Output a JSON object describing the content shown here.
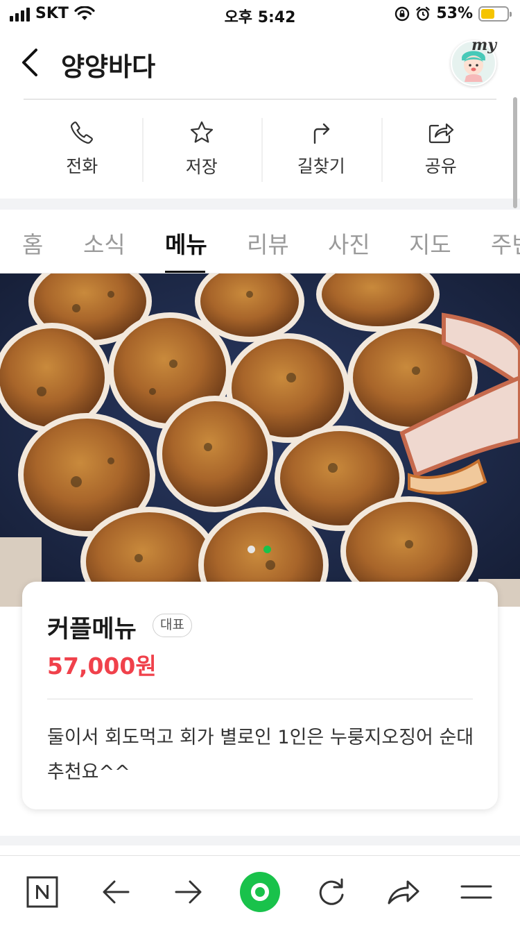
{
  "status_bar": {
    "carrier": "SKT",
    "time": "오후 5:42",
    "battery": "53%"
  },
  "header": {
    "title": "양양바다",
    "my_label": "my"
  },
  "actions": [
    {
      "label": "전화",
      "icon": "phone-icon"
    },
    {
      "label": "저장",
      "icon": "star-icon"
    },
    {
      "label": "길찾기",
      "icon": "directions-icon"
    },
    {
      "label": "공유",
      "icon": "share-icon"
    }
  ],
  "tabs": [
    {
      "label": "홈"
    },
    {
      "label": "소식"
    },
    {
      "label": "메뉴",
      "active": true
    },
    {
      "label": "리뷰"
    },
    {
      "label": "사진"
    },
    {
      "label": "지도"
    },
    {
      "label": "주변"
    }
  ],
  "photo": {
    "slide_count": 2,
    "active_slide": 2
  },
  "menu_item": {
    "name": "커플메뉴",
    "badge": "대표",
    "price": "57,000원",
    "description": "둘이서 회도먹고 회가 별로인 1인은 누룽지오징어 순대 추천요^^"
  },
  "bottom_bar": {
    "items": [
      "naver-home-icon",
      "back-arrow-icon",
      "forward-arrow-icon",
      "green-circle-icon",
      "reload-icon",
      "share-arrow-icon",
      "menu-icon"
    ]
  },
  "colors": {
    "price": "#f0414b",
    "active_dot": "#19c24b",
    "battery": "#f5c400",
    "green_button": "#19c24b"
  }
}
